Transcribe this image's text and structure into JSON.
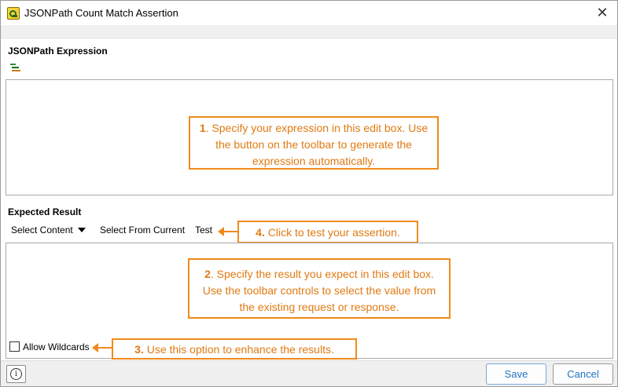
{
  "window": {
    "title": "JSONPath Count Match Assertion",
    "close_label": "✕"
  },
  "sections": {
    "jsonpath_label": "JSONPath Expression",
    "expected_label": "Expected Result"
  },
  "toolbar": {
    "select_content": "Select Content",
    "select_from_current": "Select From Current",
    "test": "Test"
  },
  "callouts": {
    "c1_num": "1",
    "c1_text": ". Specify your expression in this edit box. Use the button on the toolbar to generate the expression automatically.",
    "c2_num": "2",
    "c2_text": ". Specify the result you expect in this edit box. Use the toolbar controls to select the value from the existing request or response.",
    "c3_bold": "3.",
    "c3_text": " Use this option to enhance the results.",
    "c4_bold": "4.",
    "c4_text": " Click to test your assertion."
  },
  "options": {
    "allow_wildcards_label": "Allow Wildcards",
    "allow_wildcards_checked": false
  },
  "footer": {
    "info_label": "i",
    "save_label": "Save",
    "cancel_label": "Cancel"
  },
  "colors": {
    "callout": "#f08a1d",
    "button_text": "#1e72c8"
  }
}
